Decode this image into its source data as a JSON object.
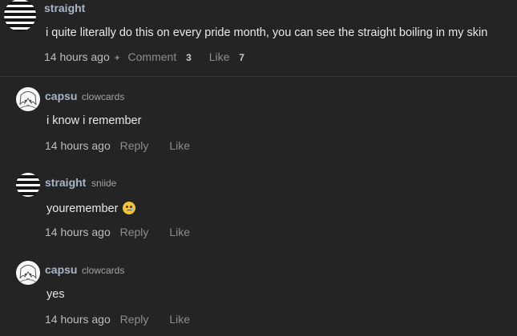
{
  "post": {
    "username": "straight",
    "text": "i quite literally do this on every pride month, you can see the straight boiling in my skin",
    "time": "14 hours ago",
    "plus": "+",
    "comment_label": "Comment",
    "comment_count": "3",
    "like_label": "Like",
    "like_count": "7",
    "avatar_icon": "striped-avatar"
  },
  "replies": [
    {
      "username": "capsu",
      "handle": "clowcards",
      "text": "i know i remember",
      "time": "14 hours ago",
      "reply_label": "Reply",
      "like_label": "Like",
      "avatar_icon": "anime-avatar"
    },
    {
      "username": "straight",
      "handle": "sniide",
      "text": "youremember",
      "emoji": "holding-back-tears-emoji",
      "time": "14 hours ago",
      "reply_label": "Reply",
      "like_label": "Like",
      "avatar_icon": "striped-avatar"
    },
    {
      "username": "capsu",
      "handle": "clowcards",
      "text": "yes",
      "time": "14 hours ago",
      "reply_label": "Reply",
      "like_label": "Like",
      "avatar_icon": "anime-avatar"
    }
  ],
  "colors": {
    "background": "#242424",
    "username": "#a9b6c7",
    "action": "#8d8d8d",
    "divider": "#3a3a3a"
  }
}
